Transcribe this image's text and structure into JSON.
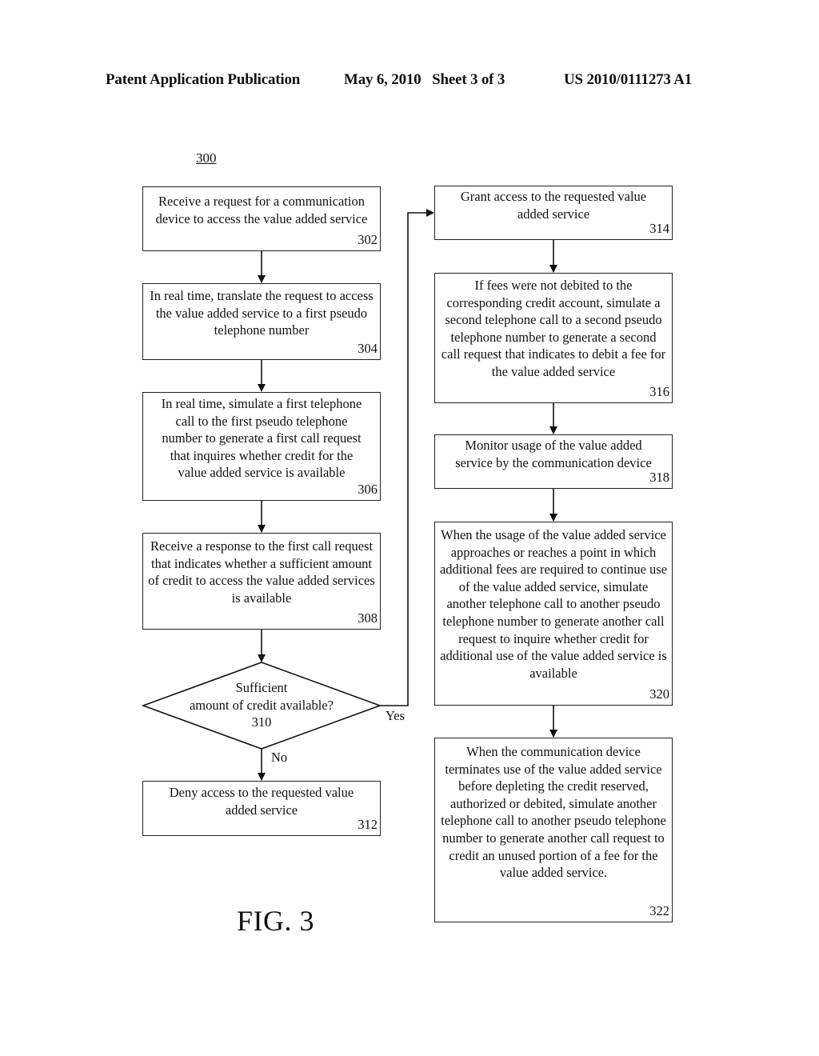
{
  "header": {
    "publication_type": "Patent Application Publication",
    "date_sheet": "May 6, 2010   Sheet 3 of 3",
    "patent_number": "US 2010/0111273 A1"
  },
  "figure": {
    "reference_number": "300",
    "label": "FIG. 3"
  },
  "steps": {
    "s302": {
      "text": "Receive a request for a communication device to access the value added service",
      "number": "302"
    },
    "s304": {
      "text": "In real time, translate the request to access the value added service to a first pseudo telephone number",
      "number": "304"
    },
    "s306": {
      "text": "In real time, simulate a first telephone call to the first pseudo telephone number to generate a first call request that inquires whether credit for the value added service is available",
      "number": "306"
    },
    "s308": {
      "text": "Receive a response to the first call request that indicates whether a sufficient amount of credit to access the value added services is available",
      "number": "308"
    },
    "s310": {
      "line1": "Sufficient",
      "line2": "amount of credit available?",
      "number": "310"
    },
    "s312": {
      "text": "Deny access to the requested value added service",
      "number": "312"
    },
    "s314": {
      "text": "Grant access to the requested value added service",
      "number": "314"
    },
    "s316": {
      "text": "If fees were not debited to the corresponding credit account, simulate a second telephone call to a second pseudo telephone number to generate a second call request that indicates to debit a fee for the value added service",
      "number": "316"
    },
    "s318": {
      "text": "Monitor usage of the value added service by the communication device",
      "number": "318"
    },
    "s320": {
      "text": "When the usage of the value added service approaches or reaches a point in which additional fees are required to continue use of the value added service, simulate another telephone call to another pseudo telephone number to generate another call request to inquire whether credit for additional use of the value added service is available",
      "number": "320"
    },
    "s322": {
      "text": "When the communication device terminates use of the value added service before depleting the credit reserved, authorized or debited, simulate another telephone call to another pseudo telephone number to generate another call request to credit an unused portion of a fee for the value added service.",
      "number": "322"
    }
  },
  "branches": {
    "yes": "Yes",
    "no": "No"
  }
}
